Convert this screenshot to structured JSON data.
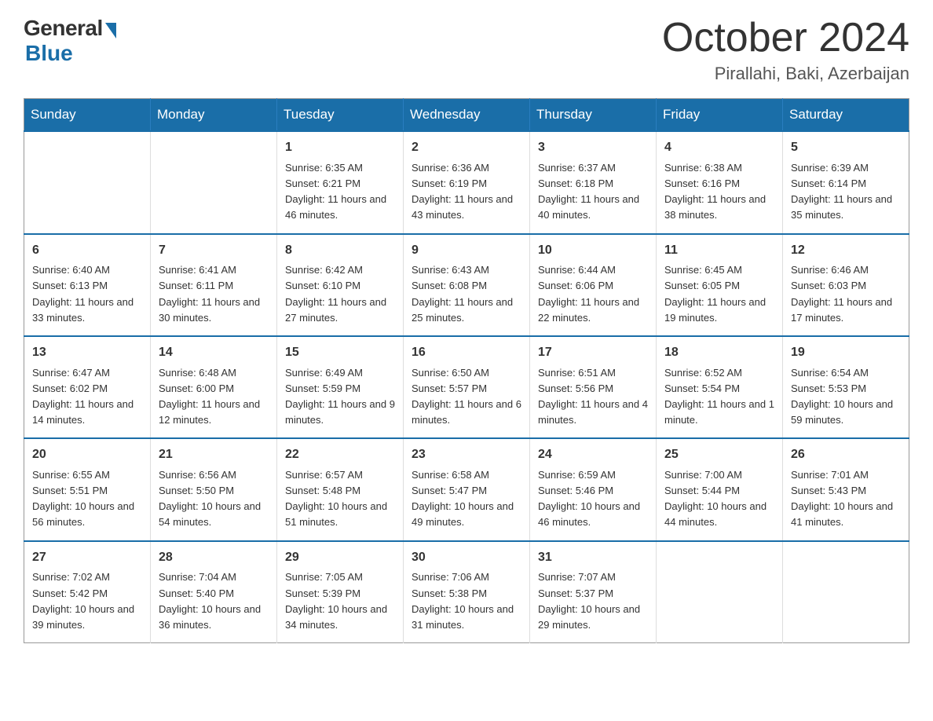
{
  "logo": {
    "general": "General",
    "blue": "Blue"
  },
  "title": "October 2024",
  "location": "Pirallahi, Baki, Azerbaijan",
  "days_of_week": [
    "Sunday",
    "Monday",
    "Tuesday",
    "Wednesday",
    "Thursday",
    "Friday",
    "Saturday"
  ],
  "weeks": [
    [
      {
        "day": "",
        "info": ""
      },
      {
        "day": "",
        "info": ""
      },
      {
        "day": "1",
        "info": "Sunrise: 6:35 AM\nSunset: 6:21 PM\nDaylight: 11 hours\nand 46 minutes."
      },
      {
        "day": "2",
        "info": "Sunrise: 6:36 AM\nSunset: 6:19 PM\nDaylight: 11 hours\nand 43 minutes."
      },
      {
        "day": "3",
        "info": "Sunrise: 6:37 AM\nSunset: 6:18 PM\nDaylight: 11 hours\nand 40 minutes."
      },
      {
        "day": "4",
        "info": "Sunrise: 6:38 AM\nSunset: 6:16 PM\nDaylight: 11 hours\nand 38 minutes."
      },
      {
        "day": "5",
        "info": "Sunrise: 6:39 AM\nSunset: 6:14 PM\nDaylight: 11 hours\nand 35 minutes."
      }
    ],
    [
      {
        "day": "6",
        "info": "Sunrise: 6:40 AM\nSunset: 6:13 PM\nDaylight: 11 hours\nand 33 minutes."
      },
      {
        "day": "7",
        "info": "Sunrise: 6:41 AM\nSunset: 6:11 PM\nDaylight: 11 hours\nand 30 minutes."
      },
      {
        "day": "8",
        "info": "Sunrise: 6:42 AM\nSunset: 6:10 PM\nDaylight: 11 hours\nand 27 minutes."
      },
      {
        "day": "9",
        "info": "Sunrise: 6:43 AM\nSunset: 6:08 PM\nDaylight: 11 hours\nand 25 minutes."
      },
      {
        "day": "10",
        "info": "Sunrise: 6:44 AM\nSunset: 6:06 PM\nDaylight: 11 hours\nand 22 minutes."
      },
      {
        "day": "11",
        "info": "Sunrise: 6:45 AM\nSunset: 6:05 PM\nDaylight: 11 hours\nand 19 minutes."
      },
      {
        "day": "12",
        "info": "Sunrise: 6:46 AM\nSunset: 6:03 PM\nDaylight: 11 hours\nand 17 minutes."
      }
    ],
    [
      {
        "day": "13",
        "info": "Sunrise: 6:47 AM\nSunset: 6:02 PM\nDaylight: 11 hours\nand 14 minutes."
      },
      {
        "day": "14",
        "info": "Sunrise: 6:48 AM\nSunset: 6:00 PM\nDaylight: 11 hours\nand 12 minutes."
      },
      {
        "day": "15",
        "info": "Sunrise: 6:49 AM\nSunset: 5:59 PM\nDaylight: 11 hours\nand 9 minutes."
      },
      {
        "day": "16",
        "info": "Sunrise: 6:50 AM\nSunset: 5:57 PM\nDaylight: 11 hours\nand 6 minutes."
      },
      {
        "day": "17",
        "info": "Sunrise: 6:51 AM\nSunset: 5:56 PM\nDaylight: 11 hours\nand 4 minutes."
      },
      {
        "day": "18",
        "info": "Sunrise: 6:52 AM\nSunset: 5:54 PM\nDaylight: 11 hours\nand 1 minute."
      },
      {
        "day": "19",
        "info": "Sunrise: 6:54 AM\nSunset: 5:53 PM\nDaylight: 10 hours\nand 59 minutes."
      }
    ],
    [
      {
        "day": "20",
        "info": "Sunrise: 6:55 AM\nSunset: 5:51 PM\nDaylight: 10 hours\nand 56 minutes."
      },
      {
        "day": "21",
        "info": "Sunrise: 6:56 AM\nSunset: 5:50 PM\nDaylight: 10 hours\nand 54 minutes."
      },
      {
        "day": "22",
        "info": "Sunrise: 6:57 AM\nSunset: 5:48 PM\nDaylight: 10 hours\nand 51 minutes."
      },
      {
        "day": "23",
        "info": "Sunrise: 6:58 AM\nSunset: 5:47 PM\nDaylight: 10 hours\nand 49 minutes."
      },
      {
        "day": "24",
        "info": "Sunrise: 6:59 AM\nSunset: 5:46 PM\nDaylight: 10 hours\nand 46 minutes."
      },
      {
        "day": "25",
        "info": "Sunrise: 7:00 AM\nSunset: 5:44 PM\nDaylight: 10 hours\nand 44 minutes."
      },
      {
        "day": "26",
        "info": "Sunrise: 7:01 AM\nSunset: 5:43 PM\nDaylight: 10 hours\nand 41 minutes."
      }
    ],
    [
      {
        "day": "27",
        "info": "Sunrise: 7:02 AM\nSunset: 5:42 PM\nDaylight: 10 hours\nand 39 minutes."
      },
      {
        "day": "28",
        "info": "Sunrise: 7:04 AM\nSunset: 5:40 PM\nDaylight: 10 hours\nand 36 minutes."
      },
      {
        "day": "29",
        "info": "Sunrise: 7:05 AM\nSunset: 5:39 PM\nDaylight: 10 hours\nand 34 minutes."
      },
      {
        "day": "30",
        "info": "Sunrise: 7:06 AM\nSunset: 5:38 PM\nDaylight: 10 hours\nand 31 minutes."
      },
      {
        "day": "31",
        "info": "Sunrise: 7:07 AM\nSunset: 5:37 PM\nDaylight: 10 hours\nand 29 minutes."
      },
      {
        "day": "",
        "info": ""
      },
      {
        "day": "",
        "info": ""
      }
    ]
  ]
}
